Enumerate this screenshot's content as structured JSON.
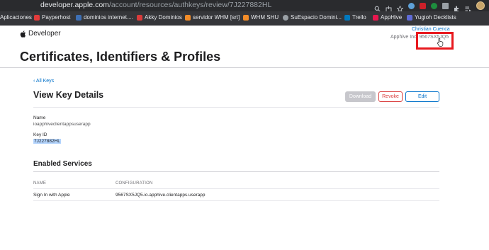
{
  "browser": {
    "url_host": "developer.apple.com",
    "url_path": "/account/resources/authkeys/review/7J227882HL"
  },
  "bookmarks": [
    {
      "label": "Aplicaciones",
      "color": "#4285f4"
    },
    {
      "label": "Payperhost",
      "color": "#e23b3b"
    },
    {
      "label": "dominios internet....",
      "color": "#3d6fb5"
    },
    {
      "label": "Akky Dominios",
      "color": "#d93b3b"
    },
    {
      "label": "servidor WHM [srt]",
      "color": "#f28c28"
    },
    {
      "label": "WHM SHU",
      "color": "#f28c28"
    },
    {
      "label": "SuEspacio Domini...",
      "color": "#9aa0a6"
    },
    {
      "label": "Trello",
      "color": "#0079bf"
    },
    {
      "label": "AppHive",
      "color": "#e8174f"
    },
    {
      "label": "Yugioh Decklists",
      "color": "#5f6bd6"
    }
  ],
  "header": {
    "brand": "Developer",
    "user_name": "Christian Cuenca",
    "team_name": "Apphive Inc.",
    "team_id": "9567SX5JQ5"
  },
  "page": {
    "title": "Certificates, Identifiers & Profiles",
    "back_link": "‹ All Keys",
    "section_title": "View Key Details",
    "buttons": {
      "download": "Download",
      "revoke": "Revoke",
      "edit": "Edit"
    }
  },
  "key": {
    "name_label": "Name",
    "name_value": "ioapphiveclientappsuserapp",
    "id_label": "Key ID",
    "id_value": "7J227882HL"
  },
  "services": {
    "title": "Enabled Services",
    "columns": [
      "NAME",
      "CONFIGURATION"
    ],
    "rows": [
      {
        "name": "Sign In with Apple",
        "configuration": "9567SX5JQ5.io.apphive.clientapps.userapp"
      }
    ]
  },
  "colors": {
    "link": "#0070c9",
    "revoke": "#d93b3b",
    "highlight": "#e8191e"
  }
}
